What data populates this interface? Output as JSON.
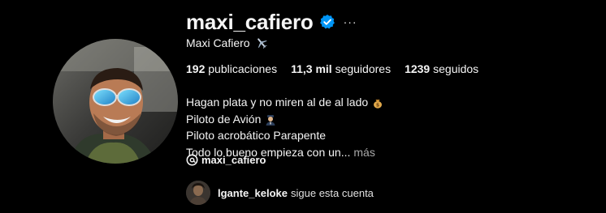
{
  "profile": {
    "username": "maxi_cafiero",
    "full_name": "Maxi Cafiero",
    "verified": true,
    "more_glyph": "···",
    "stats": {
      "posts_count": "192",
      "posts_label": "publicaciones",
      "followers_count": "11,3 mil",
      "followers_label": "seguidores",
      "following_count": "1239",
      "following_label": "seguidos"
    },
    "bio": {
      "line1": "Hagan plata y no miren al de al lado",
      "line2": "Piloto de Avión",
      "line3": "Piloto acrobático Parapente",
      "line4": "Todo lo bueno empieza con un...",
      "more_label": "más"
    },
    "threads_handle": "maxi_cafiero",
    "followed_by": {
      "name": "lgante_keloke",
      "text": "sigue esta cuenta"
    }
  },
  "colors": {
    "background": "#000000",
    "text": "#f5f5f5",
    "muted": "#a8a8a8",
    "verified_blue": "#0095f6"
  },
  "icons": {
    "verified": "verified-badge-icon",
    "plane": "airplane-emoji-icon",
    "money_bag": "money-bag-emoji-icon",
    "pilot": "pilot-emoji-icon",
    "threads": "threads-logo-icon"
  }
}
